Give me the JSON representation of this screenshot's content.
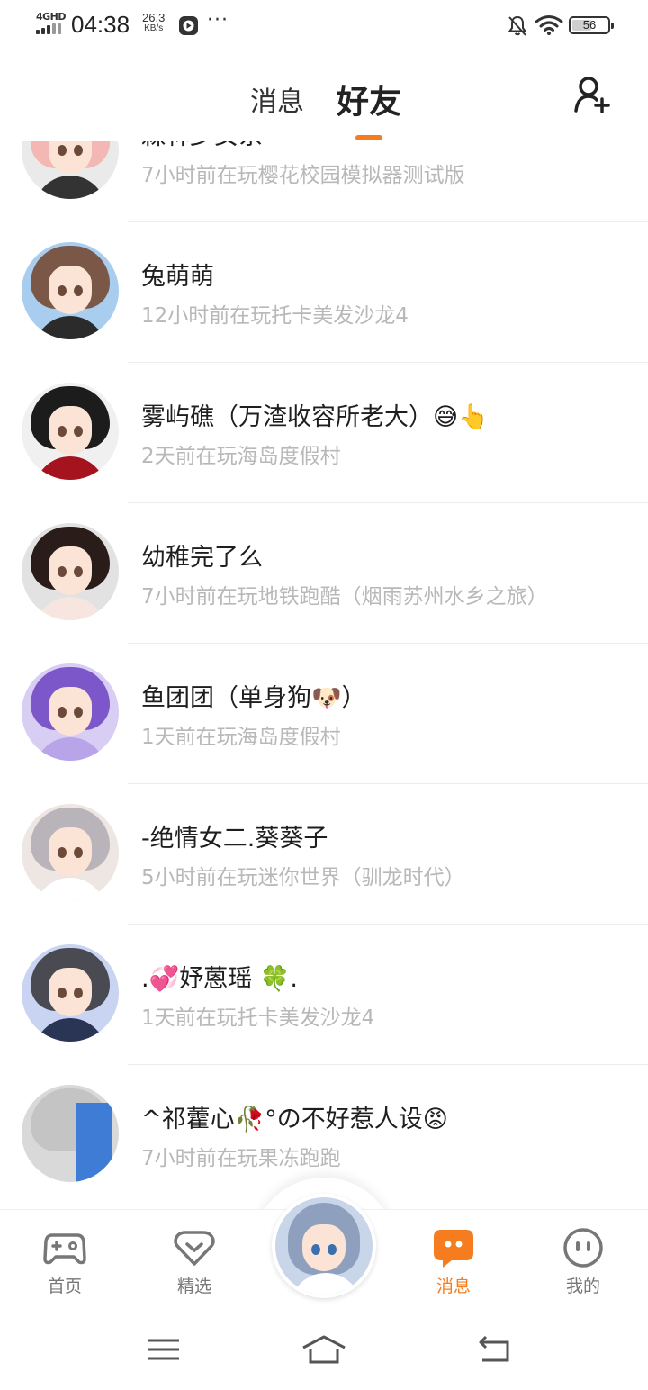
{
  "status_bar": {
    "network": "4GHD",
    "time": "04:38",
    "speed_value": "26.3",
    "speed_unit": "KB/s",
    "more": "···",
    "battery": "56",
    "battery_level": 0.56
  },
  "header": {
    "tab_messages": "消息",
    "tab_friends": "好友",
    "active_tab": "好友",
    "accent_color": "#f57c1f"
  },
  "friends": [
    {
      "name": "森林少女系",
      "status": "7小时前在玩樱花校园模拟器测试版"
    },
    {
      "name": "兔萌萌",
      "status": "12小时前在玩托卡美发沙龙4"
    },
    {
      "name": "雾屿礁（万渣收容所老大）😅👆",
      "status": "2天前在玩海岛度假村"
    },
    {
      "name": "幼稚完了么",
      "status": "7小时前在玩地铁跑酷（烟雨苏州水乡之旅）"
    },
    {
      "name": "鱼团团（单身狗🐶）",
      "status": "1天前在玩海岛度假村"
    },
    {
      "name": "-绝情女二.葵葵子",
      "status": "5小时前在玩迷你世界（驯龙时代）"
    },
    {
      "name": ".💞妤蒽瑶 🍀.",
      "status": "1天前在玩托卡美发沙龙4"
    },
    {
      "name": "^祁藿心🥀°の不好惹人设😡",
      "status": "7小时前在玩果冻跑跑"
    }
  ],
  "bottom_nav": {
    "items": [
      {
        "label": "首页",
        "icon": "gamepad-icon"
      },
      {
        "label": "精选",
        "icon": "heart-chevron-icon"
      },
      {
        "label": "消息",
        "icon": "chat-bubble-icon",
        "active": true
      },
      {
        "label": "我的",
        "icon": "smiley-icon"
      }
    ]
  }
}
